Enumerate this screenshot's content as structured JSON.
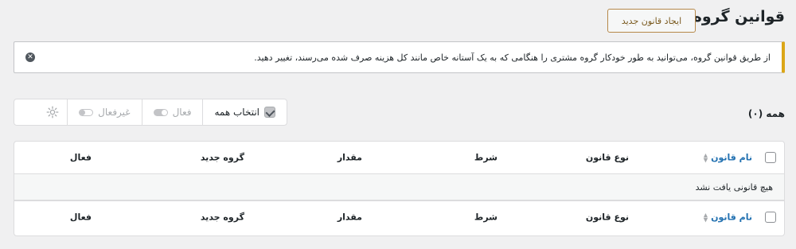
{
  "header": {
    "title": "قوانین گروه",
    "create_button": "ایجاد قانون جدید"
  },
  "notice": {
    "text": "از طریق قوانین گروه، می‌توانید به طور خودکار گروه مشتری را هنگامی که به یک آستانه خاص مانند کل هزینه صرف شده می‌رسند، تغییر دهید."
  },
  "filters": {
    "all_label": "همه (۰)"
  },
  "bulk_actions": {
    "select_all": "انتخاب همه",
    "activate": "فعال",
    "deactivate": "غیرفعال"
  },
  "table": {
    "columns": {
      "name": "نام قانون",
      "type": "نوع قانون",
      "condition": "شرط",
      "amount": "مقدار",
      "new_group": "گروه جدید",
      "active": "فعال"
    },
    "empty_message": "هیچ قانونی یافت نشد"
  }
}
